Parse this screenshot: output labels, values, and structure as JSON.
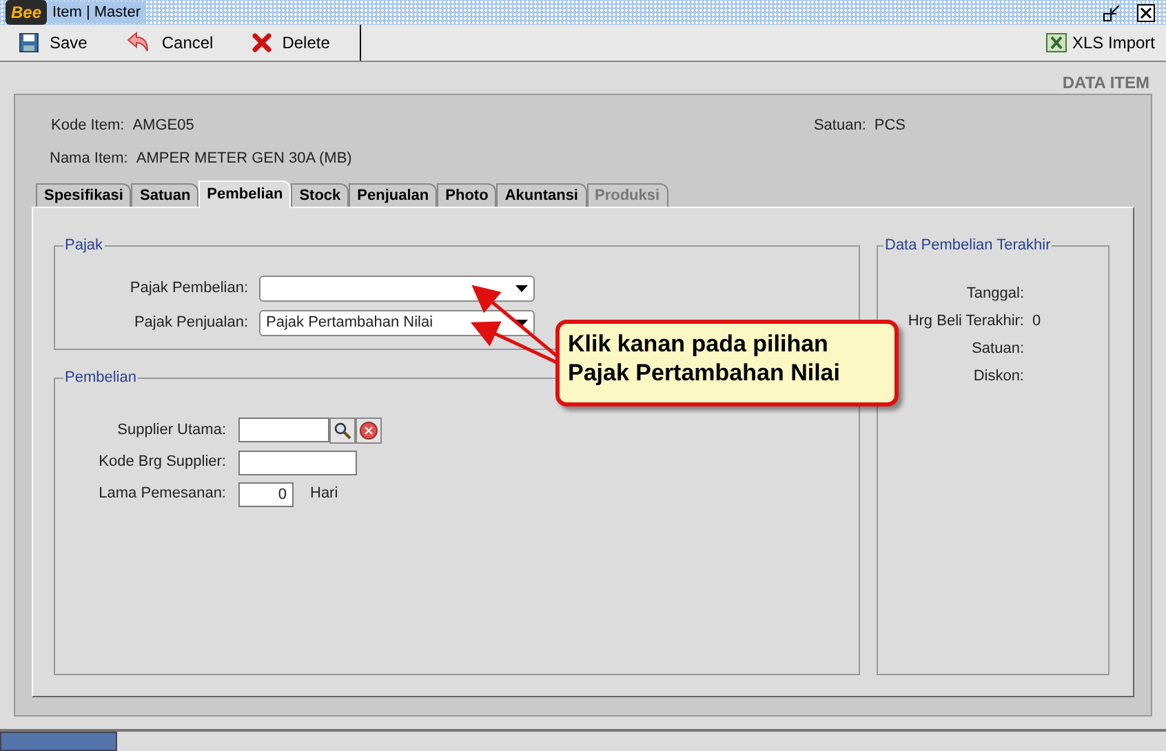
{
  "window": {
    "logo": "Bee",
    "title": "Item | Master"
  },
  "toolbar": [
    {
      "label": "Save",
      "kind": "save"
    },
    {
      "label": "Cancel",
      "kind": "cancel"
    },
    {
      "label": "Delete",
      "kind": "delete"
    }
  ],
  "toolbar_right": {
    "label": "XLS Import"
  },
  "page_title": "DATA ITEM",
  "header": {
    "kode_item": {
      "label": "Kode Item:",
      "value": "AMGE05"
    },
    "nama_item": {
      "label": "Nama Item:",
      "value": "AMPER METER GEN 30A (MB)"
    },
    "satuan": {
      "label": "Satuan:",
      "value": "PCS"
    }
  },
  "tabs": [
    {
      "label": "Spesifikasi",
      "selected": false,
      "disabled": false
    },
    {
      "label": "Satuan",
      "selected": false,
      "disabled": false
    },
    {
      "label": "Pembelian",
      "selected": true,
      "disabled": false
    },
    {
      "label": "Stock",
      "selected": false,
      "disabled": false
    },
    {
      "label": "Penjualan",
      "selected": false,
      "disabled": false
    },
    {
      "label": "Photo",
      "selected": false,
      "disabled": false
    },
    {
      "label": "Akuntansi",
      "selected": false,
      "disabled": false
    },
    {
      "label": "Produksi",
      "selected": false,
      "disabled": true
    }
  ],
  "pajak": {
    "title": "Pajak",
    "fields": [
      {
        "label": "Pajak Pembelian:"
      },
      {
        "label": "Pajak Penjualan:",
        "value": "Pajak Pertambahan Nilai"
      }
    ]
  },
  "pembelian": {
    "title": "Pembelian",
    "supplier_utama": {
      "label": "Supplier Utama:"
    },
    "kode_brg_supplier": {
      "label": "Kode Brg Supplier:"
    },
    "lama_pemesanan": {
      "label": "Lama Pemesanan:",
      "value": "0",
      "unit": "Hari"
    }
  },
  "data_pembelian_terakhir": {
    "title": "Data Pembelian Terakhir",
    "rows": [
      {
        "label": "Tanggal:"
      },
      {
        "label": "Hrg Beli Terakhir:",
        "value": "0"
      },
      {
        "label": "Satuan:"
      },
      {
        "label": "Diskon:"
      }
    ]
  },
  "status_bar": {
    "progress": {
      "level": 0.1
    }
  },
  "callout": {
    "lines": [
      "Klik kanan pada pilihan",
      "Pajak Pertambahan Nilai"
    ]
  }
}
